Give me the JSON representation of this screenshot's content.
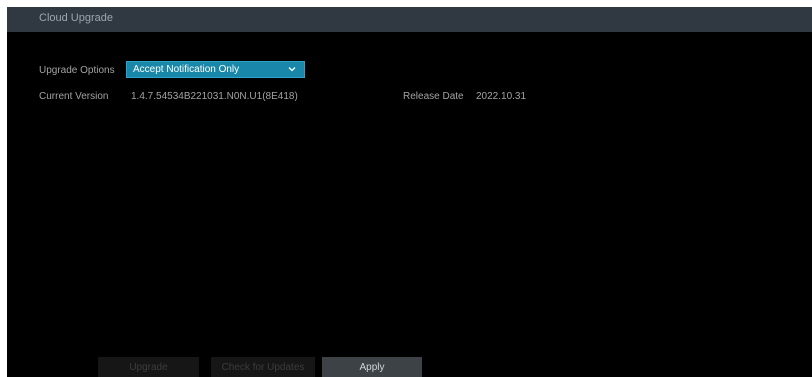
{
  "window": {
    "title": "Cloud Upgrade"
  },
  "upgrade_options": {
    "label": "Upgrade Options",
    "selected": "Accept Notification Only"
  },
  "current_version": {
    "label": "Current Version",
    "value": "1.4.7.54534B221031.N0N.U1(8E418)"
  },
  "release_date": {
    "label": "Release Date",
    "value": "2022.10.31"
  },
  "buttons": {
    "upgrade": "Upgrade",
    "check_for_updates": "Check for Updates",
    "apply": "Apply"
  },
  "colors": {
    "titlebar": "#303841",
    "dropdown": "#1987a9",
    "apply_button": "#3d4247"
  },
  "icons": {
    "dropdown": "chevron-down-icon"
  }
}
